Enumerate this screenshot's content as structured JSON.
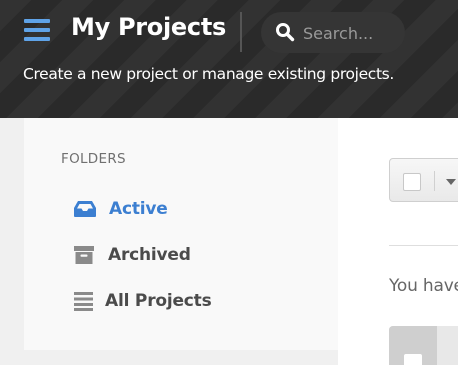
{
  "header": {
    "title": "My Projects",
    "subtitle": "Create a new project or manage existing projects.",
    "menu_icon": "hamburger-menu-icon"
  },
  "search": {
    "placeholder": "Search...",
    "value": "",
    "icon": "search-icon"
  },
  "sidebar": {
    "heading": "FOLDERS",
    "items": [
      {
        "label": "Active",
        "icon": "inbox-tray-icon",
        "selected": true
      },
      {
        "label": "Archived",
        "icon": "archive-box-icon",
        "selected": false
      },
      {
        "label": "All Projects",
        "icon": "list-icon",
        "selected": false
      }
    ]
  },
  "main": {
    "empty_message": "You have"
  },
  "colors": {
    "accent": "#3c7fd1",
    "menu_icon": "#5fa3e8",
    "header_bg": "#2a2a2a"
  }
}
